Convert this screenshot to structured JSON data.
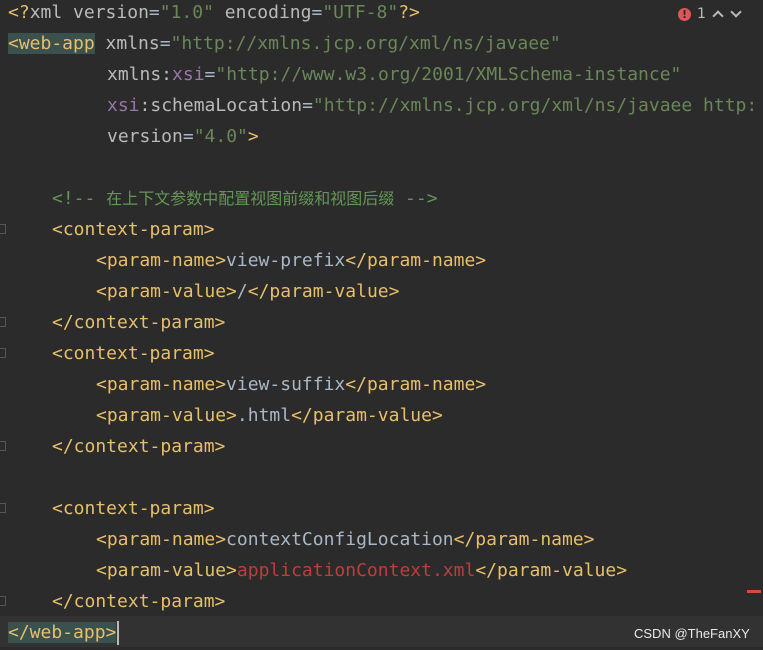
{
  "inspection": {
    "error_count": "1"
  },
  "editor": {
    "xml_decl": {
      "open": "<?",
      "name": "xml",
      "version_attr": "version",
      "version_val": "\"1.0\"",
      "encoding_attr": "encoding",
      "encoding_val": "\"UTF-8\"",
      "close": "?>"
    },
    "root_open_tag": "<web-app",
    "attr_xmlns": "xmlns",
    "eq": "=",
    "xmlns_val": "\"http://xmlns.jcp.org/xml/ns/javaee\"",
    "xmlns_prefix": "xmlns:",
    "xsi": "xsi",
    "xsi_val": "\"http://www.w3.org/2001/XMLSchema-instance\"",
    "xsi_prefix": "xsi",
    "colon": ":",
    "schema_attr": "schemaLocation",
    "schema_val": "\"http://xmlns.jcp.org/xml/ns/javaee http:",
    "version_attr": "version",
    "version_val": "\"4.0\"",
    "gt": ">",
    "comment_open": "<!-- ",
    "comment_text": "在上下文参数中配置视图前缀和视图后缀",
    "comment_close": " -->",
    "ctx_open": "<context-param>",
    "ctx_close": "</context-param>",
    "pname_open": "<param-name>",
    "pname_close": "</param-name>",
    "pvalue_open": "<param-value>",
    "pvalue_close": "</param-value>",
    "view_prefix_name": "view-prefix",
    "view_prefix_value": "/",
    "view_suffix_name": "view-suffix",
    "view_suffix_value": ".html",
    "config_name": "contextConfigLocation",
    "config_value": "applicationContext.xml",
    "root_close_tag": "</web-app>"
  },
  "watermark": "CSDN @TheFanXY"
}
